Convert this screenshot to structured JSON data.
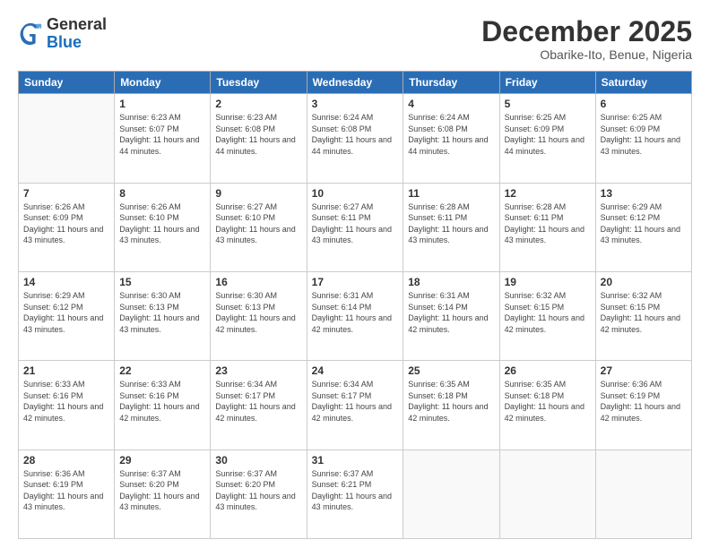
{
  "header": {
    "logo_general": "General",
    "logo_blue": "Blue",
    "month_title": "December 2025",
    "location": "Obarike-Ito, Benue, Nigeria"
  },
  "calendar": {
    "weekdays": [
      "Sunday",
      "Monday",
      "Tuesday",
      "Wednesday",
      "Thursday",
      "Friday",
      "Saturday"
    ],
    "weeks": [
      [
        {
          "day": "",
          "sunrise": "",
          "sunset": "",
          "daylight": ""
        },
        {
          "day": "1",
          "sunrise": "Sunrise: 6:23 AM",
          "sunset": "Sunset: 6:07 PM",
          "daylight": "Daylight: 11 hours and 44 minutes."
        },
        {
          "day": "2",
          "sunrise": "Sunrise: 6:23 AM",
          "sunset": "Sunset: 6:08 PM",
          "daylight": "Daylight: 11 hours and 44 minutes."
        },
        {
          "day": "3",
          "sunrise": "Sunrise: 6:24 AM",
          "sunset": "Sunset: 6:08 PM",
          "daylight": "Daylight: 11 hours and 44 minutes."
        },
        {
          "day": "4",
          "sunrise": "Sunrise: 6:24 AM",
          "sunset": "Sunset: 6:08 PM",
          "daylight": "Daylight: 11 hours and 44 minutes."
        },
        {
          "day": "5",
          "sunrise": "Sunrise: 6:25 AM",
          "sunset": "Sunset: 6:09 PM",
          "daylight": "Daylight: 11 hours and 44 minutes."
        },
        {
          "day": "6",
          "sunrise": "Sunrise: 6:25 AM",
          "sunset": "Sunset: 6:09 PM",
          "daylight": "Daylight: 11 hours and 43 minutes."
        }
      ],
      [
        {
          "day": "7",
          "sunrise": "Sunrise: 6:26 AM",
          "sunset": "Sunset: 6:09 PM",
          "daylight": "Daylight: 11 hours and 43 minutes."
        },
        {
          "day": "8",
          "sunrise": "Sunrise: 6:26 AM",
          "sunset": "Sunset: 6:10 PM",
          "daylight": "Daylight: 11 hours and 43 minutes."
        },
        {
          "day": "9",
          "sunrise": "Sunrise: 6:27 AM",
          "sunset": "Sunset: 6:10 PM",
          "daylight": "Daylight: 11 hours and 43 minutes."
        },
        {
          "day": "10",
          "sunrise": "Sunrise: 6:27 AM",
          "sunset": "Sunset: 6:11 PM",
          "daylight": "Daylight: 11 hours and 43 minutes."
        },
        {
          "day": "11",
          "sunrise": "Sunrise: 6:28 AM",
          "sunset": "Sunset: 6:11 PM",
          "daylight": "Daylight: 11 hours and 43 minutes."
        },
        {
          "day": "12",
          "sunrise": "Sunrise: 6:28 AM",
          "sunset": "Sunset: 6:11 PM",
          "daylight": "Daylight: 11 hours and 43 minutes."
        },
        {
          "day": "13",
          "sunrise": "Sunrise: 6:29 AM",
          "sunset": "Sunset: 6:12 PM",
          "daylight": "Daylight: 11 hours and 43 minutes."
        }
      ],
      [
        {
          "day": "14",
          "sunrise": "Sunrise: 6:29 AM",
          "sunset": "Sunset: 6:12 PM",
          "daylight": "Daylight: 11 hours and 43 minutes."
        },
        {
          "day": "15",
          "sunrise": "Sunrise: 6:30 AM",
          "sunset": "Sunset: 6:13 PM",
          "daylight": "Daylight: 11 hours and 43 minutes."
        },
        {
          "day": "16",
          "sunrise": "Sunrise: 6:30 AM",
          "sunset": "Sunset: 6:13 PM",
          "daylight": "Daylight: 11 hours and 42 minutes."
        },
        {
          "day": "17",
          "sunrise": "Sunrise: 6:31 AM",
          "sunset": "Sunset: 6:14 PM",
          "daylight": "Daylight: 11 hours and 42 minutes."
        },
        {
          "day": "18",
          "sunrise": "Sunrise: 6:31 AM",
          "sunset": "Sunset: 6:14 PM",
          "daylight": "Daylight: 11 hours and 42 minutes."
        },
        {
          "day": "19",
          "sunrise": "Sunrise: 6:32 AM",
          "sunset": "Sunset: 6:15 PM",
          "daylight": "Daylight: 11 hours and 42 minutes."
        },
        {
          "day": "20",
          "sunrise": "Sunrise: 6:32 AM",
          "sunset": "Sunset: 6:15 PM",
          "daylight": "Daylight: 11 hours and 42 minutes."
        }
      ],
      [
        {
          "day": "21",
          "sunrise": "Sunrise: 6:33 AM",
          "sunset": "Sunset: 6:16 PM",
          "daylight": "Daylight: 11 hours and 42 minutes."
        },
        {
          "day": "22",
          "sunrise": "Sunrise: 6:33 AM",
          "sunset": "Sunset: 6:16 PM",
          "daylight": "Daylight: 11 hours and 42 minutes."
        },
        {
          "day": "23",
          "sunrise": "Sunrise: 6:34 AM",
          "sunset": "Sunset: 6:17 PM",
          "daylight": "Daylight: 11 hours and 42 minutes."
        },
        {
          "day": "24",
          "sunrise": "Sunrise: 6:34 AM",
          "sunset": "Sunset: 6:17 PM",
          "daylight": "Daylight: 11 hours and 42 minutes."
        },
        {
          "day": "25",
          "sunrise": "Sunrise: 6:35 AM",
          "sunset": "Sunset: 6:18 PM",
          "daylight": "Daylight: 11 hours and 42 minutes."
        },
        {
          "day": "26",
          "sunrise": "Sunrise: 6:35 AM",
          "sunset": "Sunset: 6:18 PM",
          "daylight": "Daylight: 11 hours and 42 minutes."
        },
        {
          "day": "27",
          "sunrise": "Sunrise: 6:36 AM",
          "sunset": "Sunset: 6:19 PM",
          "daylight": "Daylight: 11 hours and 42 minutes."
        }
      ],
      [
        {
          "day": "28",
          "sunrise": "Sunrise: 6:36 AM",
          "sunset": "Sunset: 6:19 PM",
          "daylight": "Daylight: 11 hours and 43 minutes."
        },
        {
          "day": "29",
          "sunrise": "Sunrise: 6:37 AM",
          "sunset": "Sunset: 6:20 PM",
          "daylight": "Daylight: 11 hours and 43 minutes."
        },
        {
          "day": "30",
          "sunrise": "Sunrise: 6:37 AM",
          "sunset": "Sunset: 6:20 PM",
          "daylight": "Daylight: 11 hours and 43 minutes."
        },
        {
          "day": "31",
          "sunrise": "Sunrise: 6:37 AM",
          "sunset": "Sunset: 6:21 PM",
          "daylight": "Daylight: 11 hours and 43 minutes."
        },
        {
          "day": "",
          "sunrise": "",
          "sunset": "",
          "daylight": ""
        },
        {
          "day": "",
          "sunrise": "",
          "sunset": "",
          "daylight": ""
        },
        {
          "day": "",
          "sunrise": "",
          "sunset": "",
          "daylight": ""
        }
      ]
    ]
  }
}
